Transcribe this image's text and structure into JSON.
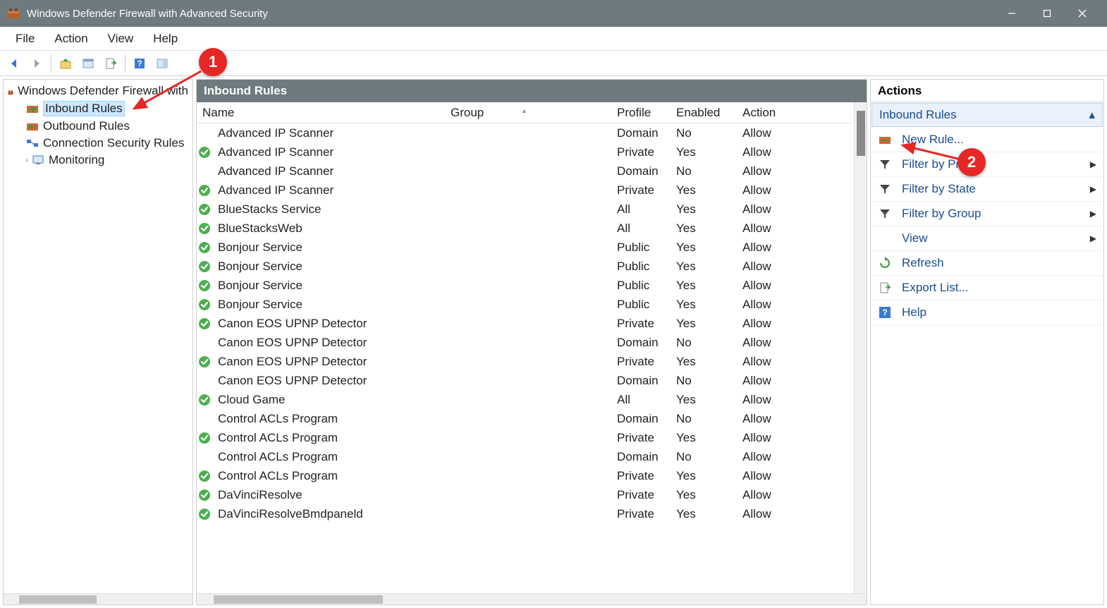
{
  "window": {
    "title": "Windows Defender Firewall with Advanced Security"
  },
  "menubar": [
    "File",
    "Action",
    "View",
    "Help"
  ],
  "tree": {
    "root": "Windows Defender Firewall with",
    "items": [
      {
        "label": "Inbound Rules",
        "icon": "inbound",
        "selected": true
      },
      {
        "label": "Outbound Rules",
        "icon": "outbound"
      },
      {
        "label": "Connection Security Rules",
        "icon": "connsec"
      },
      {
        "label": "Monitoring",
        "icon": "monitor",
        "expandable": true
      }
    ]
  },
  "rules": {
    "header": "Inbound Rules",
    "columns": {
      "name": "Name",
      "group": "Group",
      "profile": "Profile",
      "enabled": "Enabled",
      "action": "Action"
    },
    "rows": [
      {
        "chk": false,
        "name": "Advanced IP Scanner",
        "group": "",
        "profile": "Domain",
        "enabled": "No",
        "action": "Allow"
      },
      {
        "chk": true,
        "name": "Advanced IP Scanner",
        "group": "",
        "profile": "Private",
        "enabled": "Yes",
        "action": "Allow"
      },
      {
        "chk": false,
        "name": "Advanced IP Scanner",
        "group": "",
        "profile": "Domain",
        "enabled": "No",
        "action": "Allow"
      },
      {
        "chk": true,
        "name": "Advanced IP Scanner",
        "group": "",
        "profile": "Private",
        "enabled": "Yes",
        "action": "Allow"
      },
      {
        "chk": true,
        "name": "BlueStacks Service",
        "group": "",
        "profile": "All",
        "enabled": "Yes",
        "action": "Allow"
      },
      {
        "chk": true,
        "name": "BlueStacksWeb",
        "group": "",
        "profile": "All",
        "enabled": "Yes",
        "action": "Allow"
      },
      {
        "chk": true,
        "name": "Bonjour Service",
        "group": "",
        "profile": "Public",
        "enabled": "Yes",
        "action": "Allow"
      },
      {
        "chk": true,
        "name": "Bonjour Service",
        "group": "",
        "profile": "Public",
        "enabled": "Yes",
        "action": "Allow"
      },
      {
        "chk": true,
        "name": "Bonjour Service",
        "group": "",
        "profile": "Public",
        "enabled": "Yes",
        "action": "Allow"
      },
      {
        "chk": true,
        "name": "Bonjour Service",
        "group": "",
        "profile": "Public",
        "enabled": "Yes",
        "action": "Allow"
      },
      {
        "chk": true,
        "name": "Canon EOS UPNP Detector",
        "group": "",
        "profile": "Private",
        "enabled": "Yes",
        "action": "Allow"
      },
      {
        "chk": false,
        "name": "Canon EOS UPNP Detector",
        "group": "",
        "profile": "Domain",
        "enabled": "No",
        "action": "Allow"
      },
      {
        "chk": true,
        "name": "Canon EOS UPNP Detector",
        "group": "",
        "profile": "Private",
        "enabled": "Yes",
        "action": "Allow"
      },
      {
        "chk": false,
        "name": "Canon EOS UPNP Detector",
        "group": "",
        "profile": "Domain",
        "enabled": "No",
        "action": "Allow"
      },
      {
        "chk": true,
        "name": "Cloud Game",
        "group": "",
        "profile": "All",
        "enabled": "Yes",
        "action": "Allow"
      },
      {
        "chk": false,
        "name": "Control ACLs Program",
        "group": "",
        "profile": "Domain",
        "enabled": "No",
        "action": "Allow"
      },
      {
        "chk": true,
        "name": "Control ACLs Program",
        "group": "",
        "profile": "Private",
        "enabled": "Yes",
        "action": "Allow"
      },
      {
        "chk": false,
        "name": "Control ACLs Program",
        "group": "",
        "profile": "Domain",
        "enabled": "No",
        "action": "Allow"
      },
      {
        "chk": true,
        "name": "Control ACLs Program",
        "group": "",
        "profile": "Private",
        "enabled": "Yes",
        "action": "Allow"
      },
      {
        "chk": true,
        "name": "DaVinciResolve",
        "group": "",
        "profile": "Private",
        "enabled": "Yes",
        "action": "Allow"
      },
      {
        "chk": true,
        "name": "DaVinciResolveBmdpaneld",
        "group": "",
        "profile": "Private",
        "enabled": "Yes",
        "action": "Allow"
      }
    ]
  },
  "actions": {
    "header": "Actions",
    "section": "Inbound Rules",
    "items": [
      {
        "label": "New Rule...",
        "icon": "newrule"
      },
      {
        "label": "Filter by Profile",
        "icon": "filter",
        "submenu": true
      },
      {
        "label": "Filter by State",
        "icon": "filter",
        "submenu": true
      },
      {
        "label": "Filter by Group",
        "icon": "filter",
        "submenu": true
      },
      {
        "label": "View",
        "icon": "",
        "submenu": true
      },
      {
        "label": "Refresh",
        "icon": "refresh"
      },
      {
        "label": "Export List...",
        "icon": "export"
      },
      {
        "label": "Help",
        "icon": "help"
      }
    ]
  },
  "annotations": {
    "b1": "1",
    "b2": "2"
  }
}
